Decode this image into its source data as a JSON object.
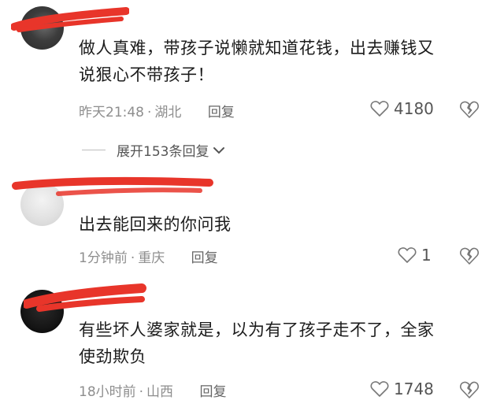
{
  "comments": [
    {
      "text_line1": "做人真难，带孩子说懒就知道花钱，出去赚钱又",
      "text_line2": "说狠心不带孩子！",
      "time": "昨天21:48",
      "location": "湖北",
      "reply_label": "回复",
      "likes": "4180",
      "expand_label": "展开153条回复"
    },
    {
      "text_line1": "出去能回来的你问我",
      "time": "1分钟前",
      "location": "重庆",
      "reply_label": "回复",
      "likes": "1"
    },
    {
      "text_line1": "有些坏人婆家就是，以为有了孩子走不了，全家",
      "text_line2": "使劲欺负",
      "time": "18小时前",
      "location": "山西",
      "reply_label": "回复",
      "likes": "1748"
    }
  ],
  "colors": {
    "redaction": "#e8352a",
    "meta_text": "#8e8e8e",
    "body_text": "#1c1c1c"
  },
  "icons": [
    "heart-outline-icon",
    "broken-heart-icon",
    "chevron-down-icon"
  ]
}
